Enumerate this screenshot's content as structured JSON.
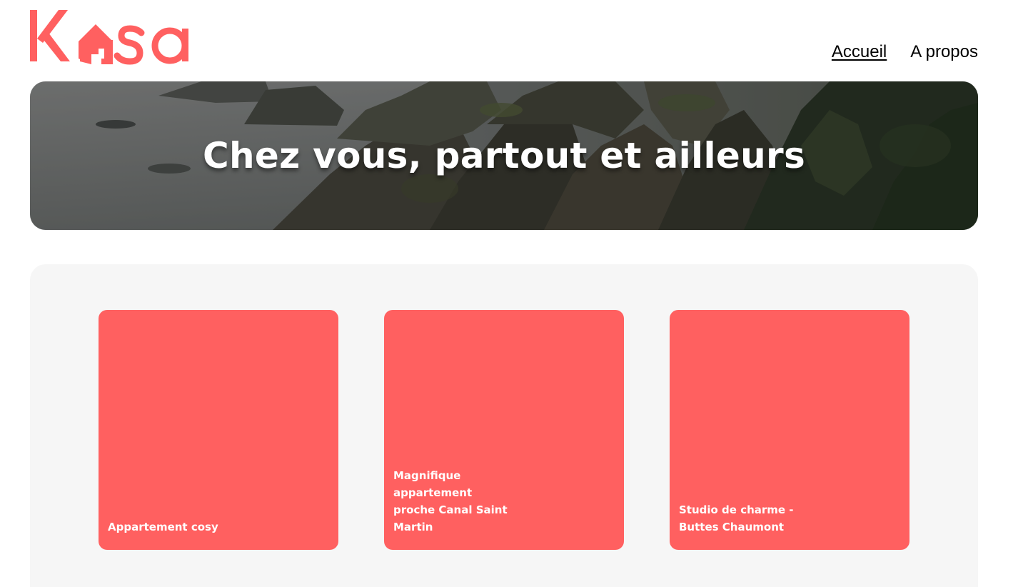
{
  "header": {
    "logo_alt": "Kasa",
    "nav": [
      {
        "label": "Accueil",
        "active": true
      },
      {
        "label": "A propos",
        "active": false
      }
    ]
  },
  "banner": {
    "title": "Chez vous, partout et ailleurs"
  },
  "gallery": {
    "cards": [
      {
        "title": "Appartement cosy"
      },
      {
        "title": "Magnifique appartement proche Canal Saint Martin"
      },
      {
        "title": "Studio de charme - Buttes Chaumont"
      }
    ]
  },
  "colors": {
    "brand": "#FF6060",
    "gallery_bg": "#F6F6F6",
    "text": "#000000"
  }
}
